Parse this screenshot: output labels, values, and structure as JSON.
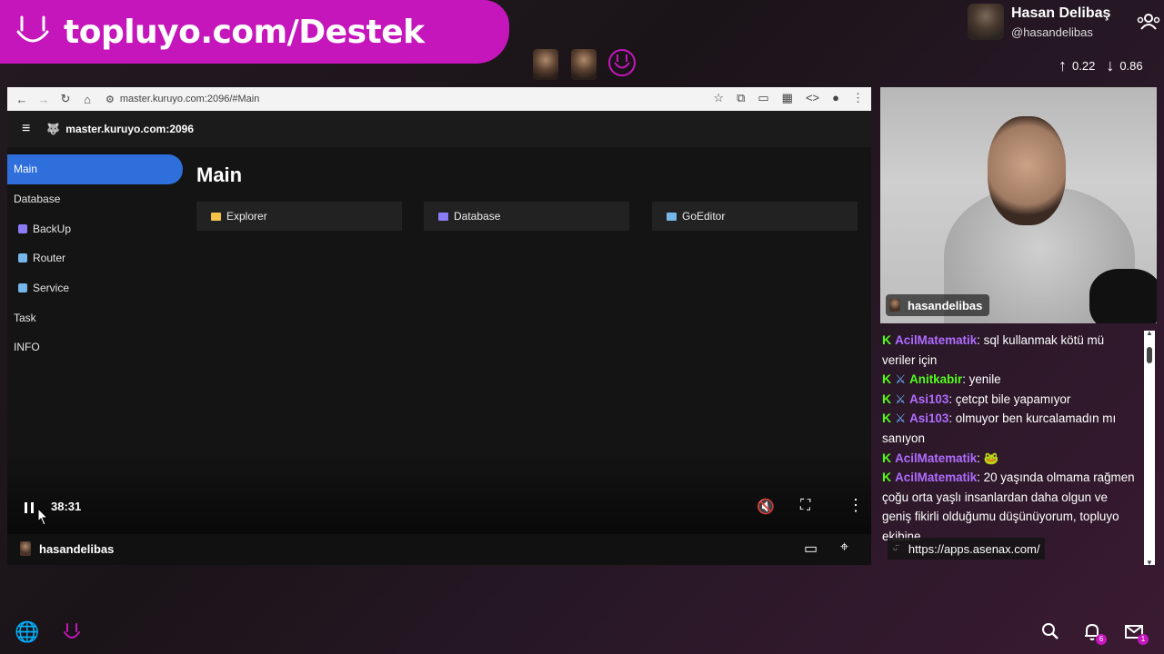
{
  "banner": {
    "text": "topluyo.com/Destek",
    "icon": "smile-logo-icon"
  },
  "profile": {
    "name": "Hasan Delibaş",
    "handle": "@hasandelibas"
  },
  "stats": {
    "up": "0.22",
    "down": "0.86"
  },
  "browser": {
    "url": "master.kuruyo.com:2096/#Main",
    "app_title": "master.kuruyo.com:2096",
    "sidebar": [
      {
        "label": "Main",
        "icon": "",
        "active": true
      },
      {
        "label": "Database",
        "icon": ""
      },
      {
        "label": "BackUp",
        "icon": "backup-icon"
      },
      {
        "label": "Router",
        "icon": "router-icon"
      },
      {
        "label": "Service",
        "icon": "service-icon"
      },
      {
        "label": "Task",
        "icon": ""
      },
      {
        "label": "INFO",
        "icon": ""
      }
    ],
    "main_title": "Main",
    "cards": [
      {
        "label": "Explorer",
        "icon": "folder-icon",
        "color": "#f5c34a"
      },
      {
        "label": "Database",
        "icon": "database-icon",
        "color": "#8b7cf6"
      },
      {
        "label": "GoEditor",
        "icon": "monitor-icon",
        "color": "#74b7e8"
      }
    ]
  },
  "player": {
    "time": "38:31",
    "streamer": "hasandelibas"
  },
  "cam": {
    "label": "hasandelibas"
  },
  "chat": {
    "messages": [
      {
        "user": "AcilMatematik",
        "color": "#b06cff",
        "sword": false,
        "text": "sql kullanmak kötü mü veriler için"
      },
      {
        "user": "Anitkabir",
        "color": "#53fc18",
        "sword": true,
        "text": "yenile"
      },
      {
        "user": "Asi103",
        "color": "#b06cff",
        "sword": true,
        "text": "çetcpt bile yapamıyor"
      },
      {
        "user": "Asi103",
        "color": "#b06cff",
        "sword": true,
        "text": "olmuyor ben kurcalamadın mı sanıyon"
      },
      {
        "user": "AcilMatematik",
        "color": "#b06cff",
        "sword": false,
        "text": "🐸"
      },
      {
        "user": "AcilMatematik",
        "color": "#b06cff",
        "sword": false,
        "text": "20 yaşında olmama rağmen çoğu orta yaşlı insanlardan daha olgun ve geniş fikirli olduğumu düşünüyorum, topluyo ekibine"
      }
    ],
    "link": "https://apps.asenax.com/"
  },
  "dock": {
    "notif_count": "6",
    "mail_count": "1"
  }
}
